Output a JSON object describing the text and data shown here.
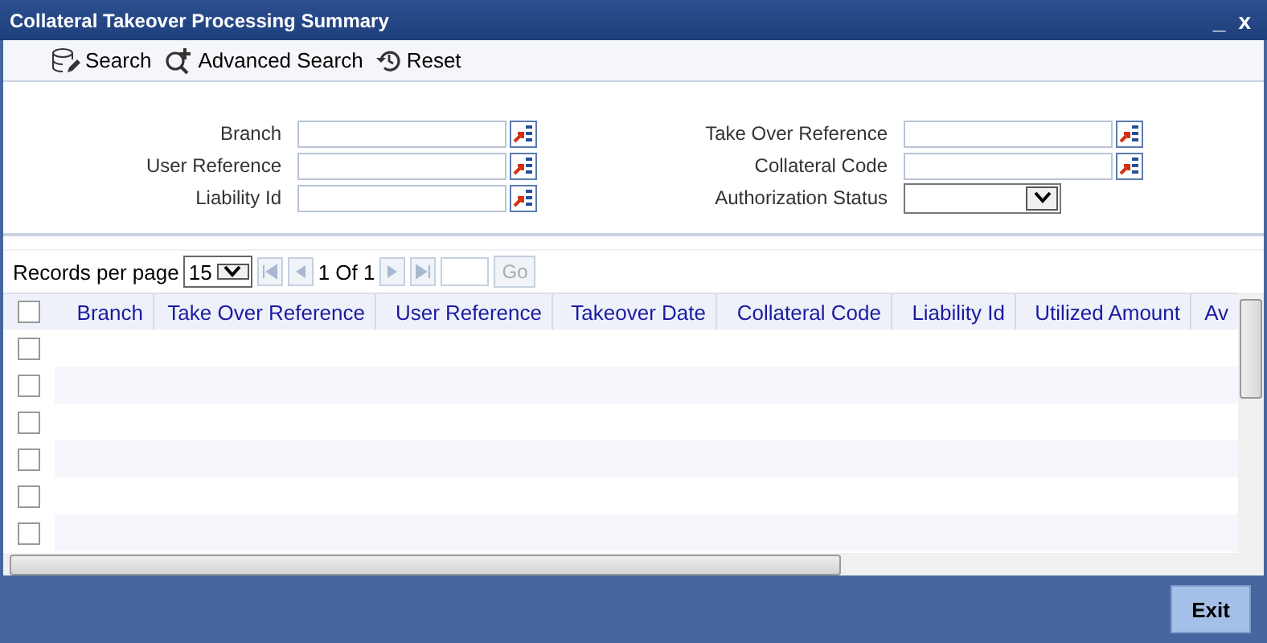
{
  "window": {
    "title": "Collateral Takeover Processing Summary",
    "controls": [
      "_",
      "x"
    ]
  },
  "toolbar": [
    {
      "kind": "search",
      "label": "Search"
    },
    {
      "kind": "advanced",
      "label": "Advanced Search"
    },
    {
      "kind": "reset",
      "label": "Reset"
    }
  ],
  "form": {
    "left": [
      {
        "label": "Branch",
        "kind": "lookup"
      },
      {
        "label": "User Reference",
        "kind": "lookup"
      },
      {
        "label": "Liability Id",
        "kind": "lookup"
      }
    ],
    "right": [
      {
        "label": "Take Over Reference",
        "kind": "lookup"
      },
      {
        "label": "Collateral Code",
        "kind": "lookup"
      },
      {
        "label": "Authorization Status",
        "kind": "select"
      }
    ]
  },
  "pager": {
    "label": "Records per page",
    "per_page": "15",
    "page_info": "1 Of 1",
    "go": "Go"
  },
  "table": {
    "columns": [
      "Branch",
      "Take Over Reference",
      "User Reference",
      "Takeover Date",
      "Collateral Code",
      "Liability Id",
      "Utilized Amount",
      "Av"
    ],
    "header_checked": false,
    "rows": [
      {
        "checked": false
      },
      {
        "checked": false
      },
      {
        "checked": false
      },
      {
        "checked": false
      },
      {
        "checked": false
      },
      {
        "checked": false
      }
    ]
  },
  "footer": {
    "exit": "Exit"
  }
}
